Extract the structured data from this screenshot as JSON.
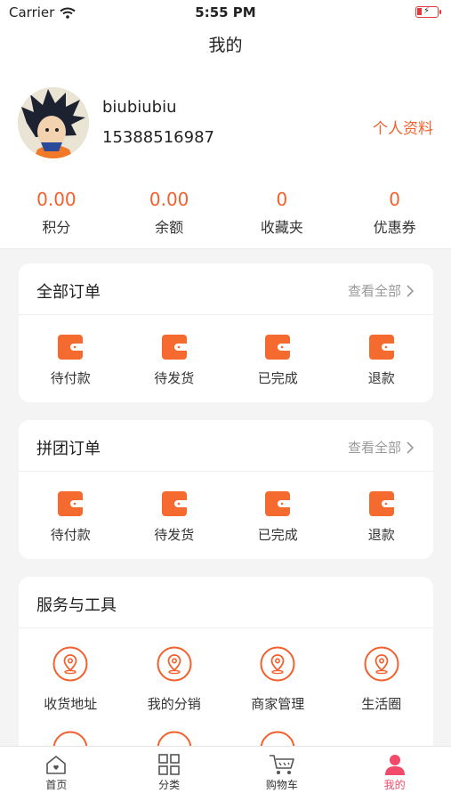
{
  "status_bar": {
    "carrier": "Carrier",
    "time": "5:55 PM"
  },
  "nav": {
    "title": "我的"
  },
  "profile": {
    "username": "biubiubiu",
    "phone": "15388516987",
    "link": "个人资料"
  },
  "stats": [
    {
      "value": "0.00",
      "label": "积分"
    },
    {
      "value": "0.00",
      "label": "余额"
    },
    {
      "value": "0",
      "label": "收藏夹"
    },
    {
      "value": "0",
      "label": "优惠券"
    }
  ],
  "orders": {
    "title": "全部订单",
    "more": "查看全部",
    "items": [
      {
        "label": "待付款",
        "icon": "wallet-icon"
      },
      {
        "label": "待发货",
        "icon": "wallet-icon"
      },
      {
        "label": "已完成",
        "icon": "wallet-icon"
      },
      {
        "label": "退款",
        "icon": "wallet-icon"
      }
    ]
  },
  "group_orders": {
    "title": "拼团订单",
    "more": "查看全部",
    "items": [
      {
        "label": "待付款",
        "icon": "wallet-icon"
      },
      {
        "label": "待发货",
        "icon": "wallet-icon"
      },
      {
        "label": "已完成",
        "icon": "wallet-icon"
      },
      {
        "label": "退款",
        "icon": "wallet-icon"
      }
    ]
  },
  "services": {
    "title": "服务与工具",
    "items": [
      {
        "label": "收货地址",
        "icon": "location-icon"
      },
      {
        "label": "我的分销",
        "icon": "location-icon"
      },
      {
        "label": "商家管理",
        "icon": "location-icon"
      },
      {
        "label": "生活圈",
        "icon": "location-icon"
      }
    ]
  },
  "tabbar": [
    {
      "label": "首页",
      "icon": "home-icon"
    },
    {
      "label": "分类",
      "icon": "grid-icon"
    },
    {
      "label": "购物车",
      "icon": "cart-icon"
    },
    {
      "label": "我的",
      "icon": "user-icon",
      "active": true
    }
  ],
  "colors": {
    "accent": "#f2602e",
    "active_tab": "#f24a6b",
    "background": "#f4f4f4"
  }
}
